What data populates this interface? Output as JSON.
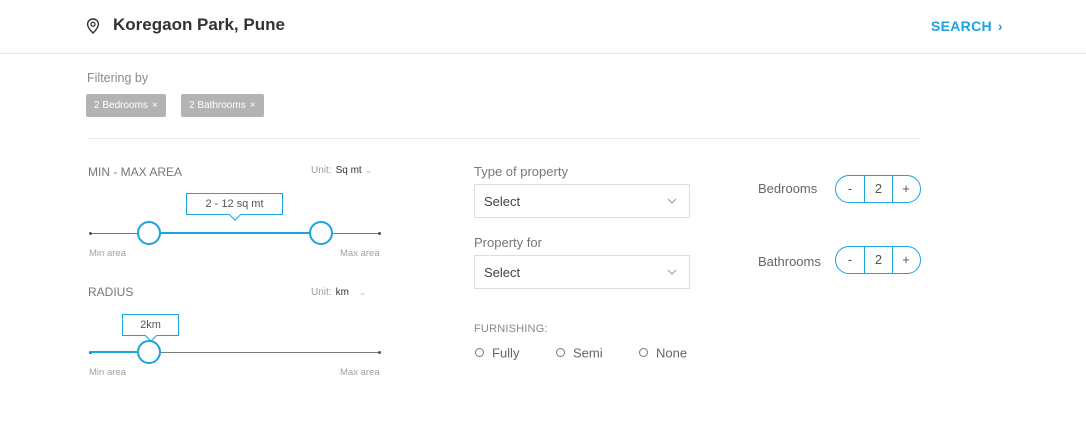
{
  "header": {
    "location": "Koregaon Park, Pune",
    "search_label": "SEARCH",
    "search_chevron": "›",
    "accent_color": "#1aa3dd",
    "location_icon": "location-pin-icon"
  },
  "filters": {
    "label": "Filtering by",
    "chips": [
      {
        "label": "2 Bedrooms",
        "remove": "×"
      },
      {
        "label": "2 Bathrooms",
        "remove": "×"
      }
    ]
  },
  "area": {
    "title": "MIN - MAX AREA",
    "unit_label": "Unit:",
    "unit_value": "Sq mt",
    "unit_caret": "⌄",
    "bubble": "2 - 12 sq mt",
    "min_label": "Min area",
    "max_label": "Max area"
  },
  "radius": {
    "title": "RADIUS",
    "unit_label": "Unit:",
    "unit_value": "km",
    "unit_caret": "⌄",
    "bubble": "2km",
    "min_label": "Min area",
    "max_label": "Max area"
  },
  "property_type": {
    "label": "Type of property",
    "value": "Select"
  },
  "property_for": {
    "label": "Property for",
    "value": "Select"
  },
  "furnishing": {
    "label": "FURNISHING:",
    "options": [
      "Fully",
      "Semi",
      "None"
    ]
  },
  "bedrooms": {
    "label": "Bedrooms",
    "minus": "-",
    "value": "2",
    "plus": "+"
  },
  "bathrooms": {
    "label": "Bathrooms",
    "minus": "-",
    "value": "2",
    "plus": "+"
  }
}
